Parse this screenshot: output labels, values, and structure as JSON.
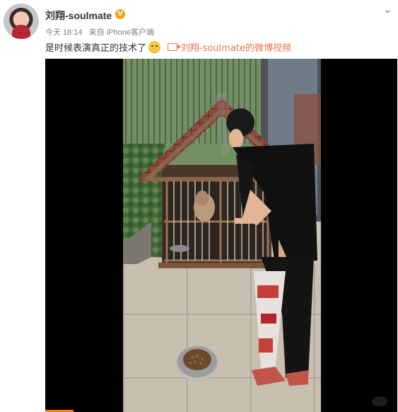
{
  "post": {
    "username": "刘翔-soulmate",
    "verified_badge": "V",
    "time": "今天 18:14",
    "source": "来自 iPhone客户端",
    "content": "是时候表演真正的技术了",
    "video_link": "刘翔-soulmate的微博视频"
  },
  "icons": {
    "menu": "chevron-down-icon",
    "video": "video-icon",
    "emoji": "emoji-smirk-icon",
    "badge": "verified-badge-icon"
  },
  "video": {
    "progress_fraction": 0.08
  },
  "colors": {
    "accent": "#eb7350",
    "verified": "#ffa00a",
    "text": "#333333",
    "meta": "#808080"
  }
}
